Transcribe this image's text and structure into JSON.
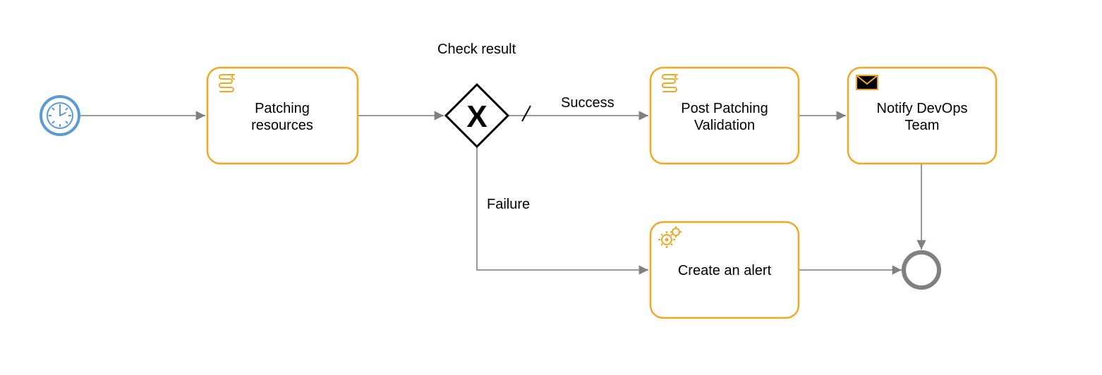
{
  "diagram": {
    "start": {
      "type": "timer-start-event"
    },
    "gateway": {
      "label": "Check result",
      "type": "exclusive"
    },
    "tasks": {
      "patching": {
        "line1": "Patching",
        "line2": "resources",
        "icon": "script"
      },
      "validation": {
        "line1": "Post Patching",
        "line2": "Validation",
        "icon": "script"
      },
      "notify": {
        "line1": "Notify DevOps",
        "line2": "Team",
        "icon": "message"
      },
      "alert": {
        "line1": "Create an alert",
        "line2": "",
        "icon": "service"
      }
    },
    "flows": {
      "success": "Success",
      "failure": "Failure"
    },
    "end": {
      "type": "end-event"
    },
    "colors": {
      "task_border": "#F5A623",
      "start_border": "#5B9BD5",
      "connector": "#9b9b9b",
      "end_border": "#808080"
    }
  }
}
